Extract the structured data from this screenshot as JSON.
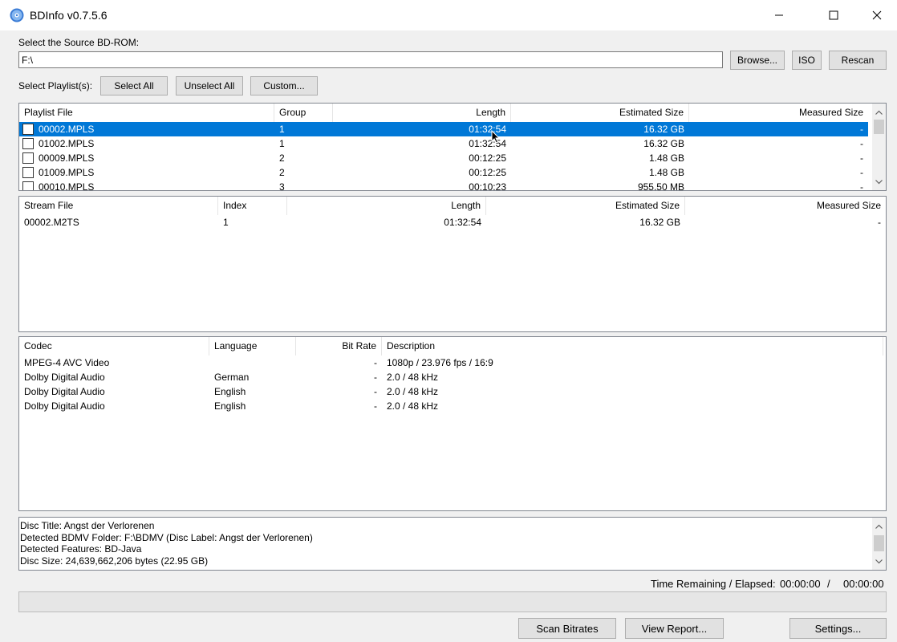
{
  "window": {
    "title": "BDInfo v0.7.5.6"
  },
  "source": {
    "label": "Select the Source BD-ROM:",
    "path": "F:\\",
    "browse_label": "Browse...",
    "iso_label": "ISO",
    "rescan_label": "Rescan"
  },
  "playlists": {
    "label": "Select Playlist(s):",
    "select_all_label": "Select All",
    "unselect_all_label": "Unselect All",
    "custom_label": "Custom...",
    "columns": [
      "Playlist File",
      "Group",
      "Length",
      "Estimated Size",
      "Measured Size"
    ],
    "rows": [
      {
        "file": "00002.MPLS",
        "group": "1",
        "length": "01:32:54",
        "est": "16.32 GB",
        "measured": "-"
      },
      {
        "file": "01002.MPLS",
        "group": "1",
        "length": "01:32:54",
        "est": "16.32 GB",
        "measured": "-"
      },
      {
        "file": "00009.MPLS",
        "group": "2",
        "length": "00:12:25",
        "est": "1.48 GB",
        "measured": "-"
      },
      {
        "file": "01009.MPLS",
        "group": "2",
        "length": "00:12:25",
        "est": "1.48 GB",
        "measured": "-"
      },
      {
        "file": "00010.MPLS",
        "group": "3",
        "length": "00:10:23",
        "est": "955.50 MB",
        "measured": "-"
      }
    ]
  },
  "streams": {
    "columns": [
      "Stream File",
      "Index",
      "Length",
      "Estimated Size",
      "Measured Size"
    ],
    "rows": [
      {
        "file": "00002.M2TS",
        "index": "1",
        "length": "01:32:54",
        "est": "16.32 GB",
        "measured": "-"
      }
    ]
  },
  "codecs": {
    "columns": [
      "Codec",
      "Language",
      "Bit Rate",
      "Description"
    ],
    "rows": [
      {
        "codec": "MPEG-4 AVC Video",
        "language": "",
        "bitrate": "-",
        "desc": "1080p / 23.976 fps / 16:9"
      },
      {
        "codec": "Dolby Digital Audio",
        "language": "German",
        "bitrate": "-",
        "desc": "2.0 / 48 kHz"
      },
      {
        "codec": "Dolby Digital Audio",
        "language": "English",
        "bitrate": "-",
        "desc": "2.0 / 48 kHz"
      },
      {
        "codec": "Dolby Digital Audio",
        "language": "English",
        "bitrate": "-",
        "desc": "2.0 / 48 kHz"
      }
    ]
  },
  "info": {
    "lines": [
      "Disc Title: Angst der Verlorenen",
      "Detected BDMV Folder: F:\\BDMV (Disc Label: Angst der Verlorenen)",
      "Detected Features: BD-Java",
      "Disc Size: 24,639,662,206 bytes (22.95 GB)"
    ]
  },
  "status": {
    "time_label": "Time Remaining / Elapsed:",
    "remaining": "00:00:00",
    "separator": "/",
    "elapsed": "00:00:00",
    "progress": 0
  },
  "footer": {
    "scan_label": "Scan Bitrates",
    "report_label": "View Report...",
    "settings_label": "Settings..."
  },
  "icons": {
    "app": "bluray-disc-icon",
    "minimize": "minimize-icon",
    "maximize": "maximize-icon",
    "close": "close-icon"
  },
  "colors": {
    "selection": "#0078d7"
  }
}
